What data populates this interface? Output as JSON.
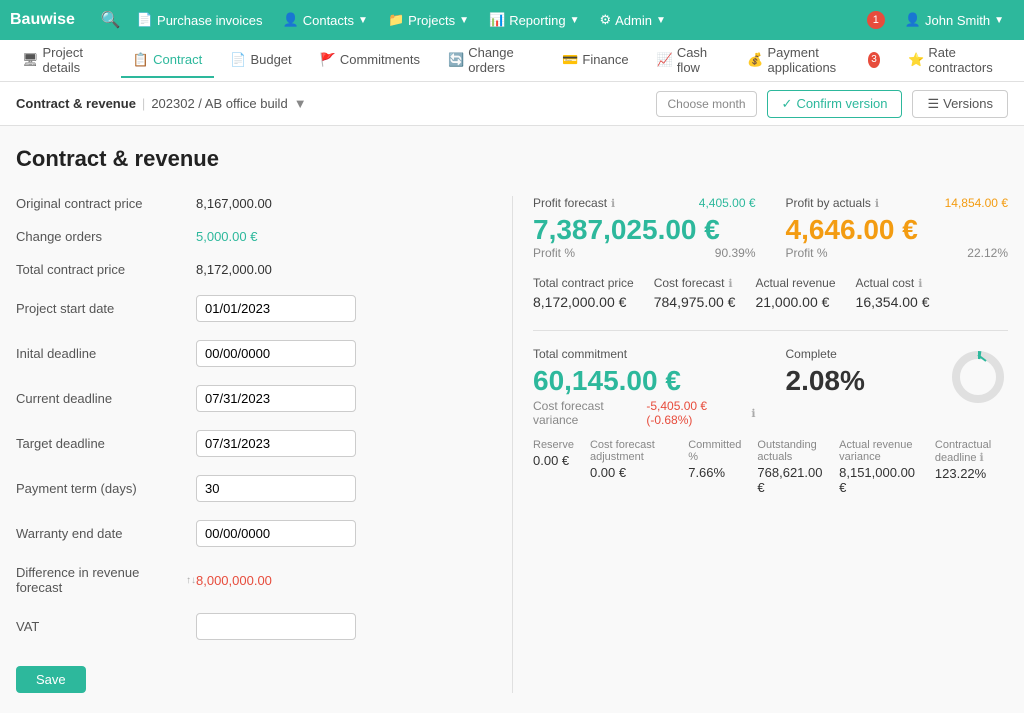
{
  "brand": "Bauwise",
  "navbar": {
    "search_icon": "🔍",
    "items": [
      {
        "label": "Purchase invoices",
        "icon": "📄"
      },
      {
        "label": "Contacts",
        "icon": "👤",
        "has_dropdown": true
      },
      {
        "label": "Projects",
        "icon": "📁",
        "has_dropdown": true
      },
      {
        "label": "Reporting",
        "icon": "📊",
        "has_dropdown": true
      },
      {
        "label": "Admin",
        "icon": "⚙",
        "has_dropdown": true
      }
    ],
    "notification_count": "1",
    "user": "John Smith"
  },
  "subnav": {
    "items": [
      {
        "label": "Project details",
        "icon": "🖥",
        "active": false
      },
      {
        "label": "Contract",
        "icon": "📋",
        "active": true
      },
      {
        "label": "Budget",
        "icon": "📄",
        "active": false
      },
      {
        "label": "Commitments",
        "icon": "🚩",
        "active": false
      },
      {
        "label": "Change orders",
        "icon": "🔄",
        "active": false
      },
      {
        "label": "Finance",
        "icon": "💳",
        "active": false
      },
      {
        "label": "Cash flow",
        "icon": "📈",
        "active": false
      },
      {
        "label": "Payment applications",
        "icon": "💰",
        "active": false,
        "badge": "3"
      },
      {
        "label": "Rate contractors",
        "icon": "⭐",
        "active": false
      }
    ]
  },
  "breadcrumb": {
    "title": "Contract & revenue",
    "project": "202302 / AB office build",
    "choose_month": "Choose month",
    "confirm_version": "Confirm version",
    "versions": "Versions"
  },
  "page": {
    "title": "Contract & revenue",
    "form": {
      "original_contract_price_label": "Original contract price",
      "original_contract_price_value": "8,167,000.00",
      "change_orders_label": "Change orders",
      "change_orders_value": "5,000.00 €",
      "total_contract_price_label": "Total contract price",
      "total_contract_price_value": "8,172,000.00",
      "project_start_date_label": "Project start date",
      "project_start_date_value": "01/01/2023",
      "initial_deadline_label": "Inital deadline",
      "initial_deadline_value": "00/00/0000",
      "current_deadline_label": "Current deadline",
      "current_deadline_value": "07/31/2023",
      "target_deadline_label": "Target deadline",
      "target_deadline_value": "07/31/2023",
      "payment_term_label": "Payment term (days)",
      "payment_term_value": "30",
      "warranty_end_date_label": "Warranty end date",
      "warranty_end_date_value": "00/00/0000",
      "diff_revenue_label": "Difference in revenue forecast",
      "diff_revenue_value": "8,000,000.00",
      "vat_label": "VAT",
      "vat_value": ""
    },
    "save_label": "Save",
    "stats": {
      "profit_forecast_label": "Profit forecast",
      "profit_forecast_badge": "4,405.00 €",
      "profit_forecast_main": "7,387,025.00 €",
      "profit_forecast_sub": "Profit %",
      "profit_forecast_pct": "90.39%",
      "profit_actuals_label": "Profit by actuals",
      "profit_actuals_badge": "14,854.00 €",
      "profit_actuals_main": "4,646.00 €",
      "profit_actuals_sub": "Profit %",
      "profit_actuals_pct": "22.12%",
      "total_contract_price_label": "Total contract price",
      "total_contract_price_val": "8,172,000.00 €",
      "cost_forecast_label": "Cost forecast",
      "cost_forecast_val": "784,975.00 €",
      "actual_revenue_label": "Actual revenue",
      "actual_revenue_val": "21,000.00 €",
      "actual_cost_label": "Actual cost",
      "actual_cost_val": "16,354.00 €",
      "total_commitment_label": "Total commitment",
      "total_commitment_main": "60,145.00 €",
      "cost_forecast_variance_label": "Cost forecast variance",
      "cost_forecast_variance_val": "-5,405.00 € (-0.68%)",
      "reserve_label": "Reserve",
      "reserve_val": "0.00 €",
      "cost_forecast_adj_label": "Cost forecast adjustment",
      "cost_forecast_adj_val": "0.00 €",
      "committed_pct_label": "Committed %",
      "committed_pct_val": "7.66%",
      "complete_label": "Complete",
      "complete_pct": "2.08%",
      "outstanding_actuals_label": "Outstanding actuals",
      "outstanding_actuals_val": "768,621.00 €",
      "actual_revenue_variance_label": "Actual revenue variance",
      "actual_revenue_variance_val": "8,151,000.00 €",
      "contractual_deadline_label": "Contractual deadline",
      "contractual_deadline_val": "123.22%"
    }
  }
}
